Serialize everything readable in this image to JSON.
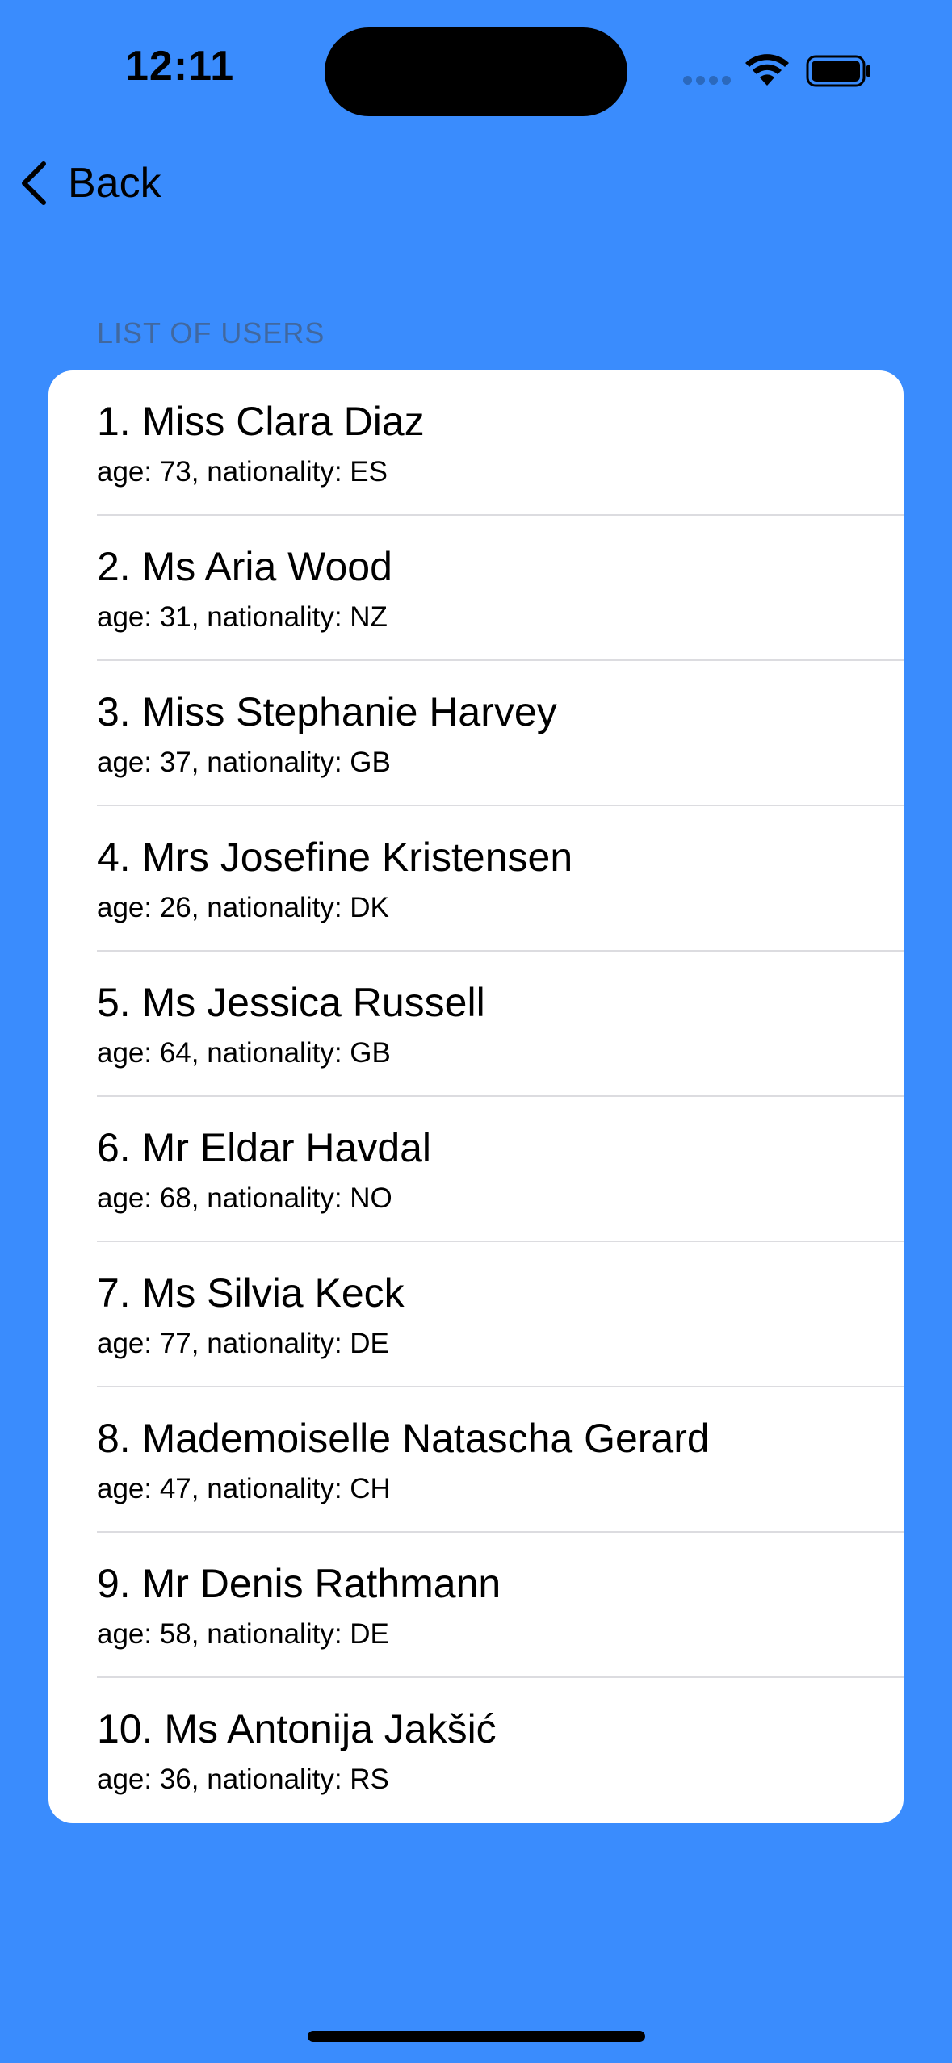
{
  "status_bar": {
    "time": "12:11"
  },
  "nav": {
    "back_label": "Back"
  },
  "list": {
    "header": "LIST OF USERS",
    "users": [
      {
        "title": "1. Miss Clara Diaz",
        "subtitle": "age: 73, nationality: ES"
      },
      {
        "title": "2. Ms Aria Wood",
        "subtitle": "age: 31, nationality: NZ"
      },
      {
        "title": "3. Miss Stephanie Harvey",
        "subtitle": "age: 37, nationality: GB"
      },
      {
        "title": "4. Mrs Josefine Kristensen",
        "subtitle": "age: 26, nationality: DK"
      },
      {
        "title": "5. Ms Jessica Russell",
        "subtitle": "age: 64, nationality: GB"
      },
      {
        "title": "6. Mr Eldar Havdal",
        "subtitle": "age: 68, nationality: NO"
      },
      {
        "title": "7. Ms Silvia Keck",
        "subtitle": "age: 77, nationality: DE"
      },
      {
        "title": "8. Mademoiselle Natascha Gerard",
        "subtitle": "age: 47, nationality: CH"
      },
      {
        "title": "9. Mr Denis Rathmann",
        "subtitle": "age: 58, nationality: DE"
      },
      {
        "title": "10. Ms Antonija Jakšić",
        "subtitle": "age: 36, nationality: RS"
      }
    ]
  },
  "colors": {
    "background": "#3a8cfd",
    "card": "#ffffff",
    "section_header": "#41689f"
  }
}
